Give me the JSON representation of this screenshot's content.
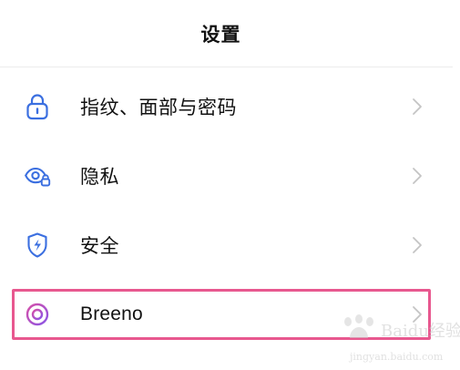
{
  "header": {
    "title": "设置"
  },
  "settings": {
    "items": [
      {
        "label": "指纹、面部与密码",
        "icon": "lock-icon"
      },
      {
        "label": "隐私",
        "icon": "privacy-eye-lock-icon"
      },
      {
        "label": "安全",
        "icon": "security-shield-icon"
      },
      {
        "label": "Breeno",
        "icon": "breeno-ring-icon"
      }
    ]
  },
  "colors": {
    "icon_blue": "#3b6fe0",
    "breeno_pink": "#d64fa8",
    "breeno_purple": "#8a55e6",
    "highlight_border": "#e8588f",
    "chevron_gray": "#c4c4c4",
    "divider": "#ececec"
  },
  "watermark": {
    "brand": "Baidu经验",
    "url": "jingyan.baidu.com"
  }
}
